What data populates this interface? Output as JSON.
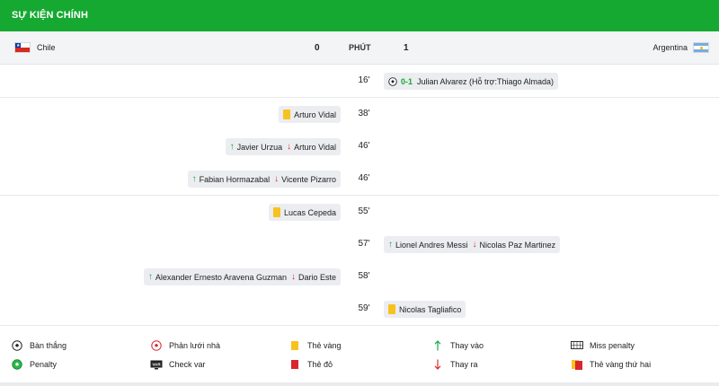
{
  "title": "SỰ KIỆN CHÍNH",
  "header": {
    "home_team": "Chile",
    "away_team": "Argentina",
    "home_score": "0",
    "away_score": "1",
    "minute_label": "PHÚT"
  },
  "events": [
    {
      "minute": "16'",
      "side": "away",
      "type": "goal",
      "score": "0-1",
      "text": "Julian Alvarez (Hỗ trợ:Thiago Almada)"
    },
    {
      "minute": "38'",
      "side": "home",
      "type": "yellow",
      "text": "Arturo Vidal"
    },
    {
      "minute": "46'",
      "side": "home",
      "type": "sub",
      "in": "Javier Urzua",
      "out": "Arturo Vidal"
    },
    {
      "minute": "46'",
      "side": "home",
      "type": "sub",
      "in": "Fabian Hormazabal",
      "out": "Vicente Pizarro"
    },
    {
      "minute": "55'",
      "side": "home",
      "type": "yellow",
      "text": "Lucas Cepeda"
    },
    {
      "minute": "57'",
      "side": "away",
      "type": "sub",
      "in": "Lionel Andres Messi",
      "out": "Nicolas Paz Martinez"
    },
    {
      "minute": "58'",
      "side": "home",
      "type": "sub",
      "in": "Alexander Ernesto Aravena Guzman",
      "out": "Dario Este"
    },
    {
      "minute": "59'",
      "side": "away",
      "type": "yellow",
      "text": "Nicolas Tagliafico"
    }
  ],
  "legend": {
    "goal": "Bàn thắng",
    "own_goal": "Phản lưới nhà",
    "yellow": "Thẻ vàng",
    "sub_in": "Thay vào",
    "miss_penalty": "Miss penalty",
    "penalty": "Penalty",
    "check_var": "Check var",
    "red": "Thẻ đỏ",
    "sub_out": "Thay ra",
    "second_yellow": "Thẻ vàng thứ hai",
    "var_badge": "VAR"
  },
  "icons": {
    "arrow_up": "↑",
    "arrow_down": "↓",
    "star": "★"
  },
  "colors": {
    "brand_green": "#16a932",
    "yellow_card": "#f7c21e",
    "red_card": "#d9262c",
    "arrow_in": "#1aa64a",
    "arrow_out": "#e02a2a"
  }
}
